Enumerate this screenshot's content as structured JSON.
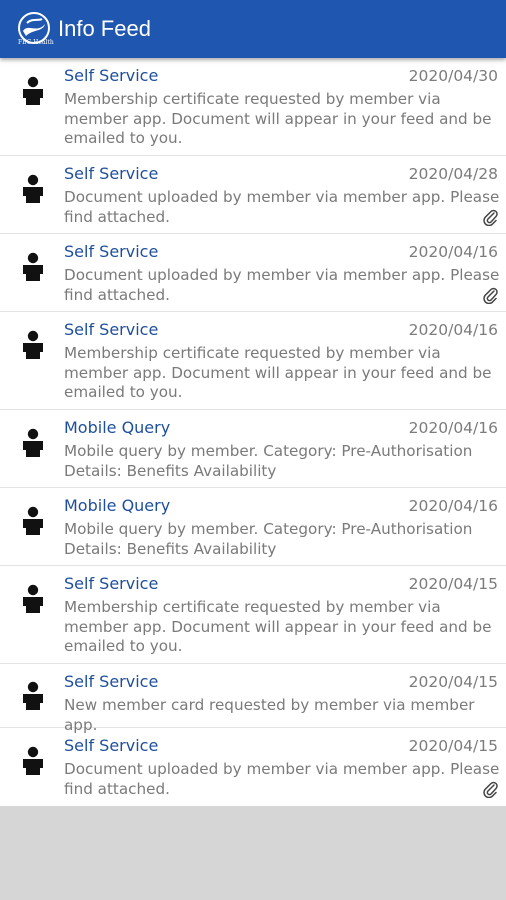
{
  "appbar": {
    "title": "Info Feed",
    "logo_text": "FBC Health",
    "color": "#1f56b0"
  },
  "feed": [
    {
      "source": "Self Service",
      "date": "2020/04/30",
      "text": "Membership certificate requested by member via member app. Document will appear in your feed and be emailed to you.",
      "attachment": false
    },
    {
      "source": "Self Service",
      "date": "2020/04/28",
      "text": "Document uploaded by member via member app. Please find attached.",
      "attachment": true
    },
    {
      "source": "Self Service",
      "date": "2020/04/16",
      "text": "Document uploaded by member via member app. Please find attached.",
      "attachment": true
    },
    {
      "source": "Self Service",
      "date": "2020/04/16",
      "text": "Membership certificate requested by member via member app. Document will appear in your feed and be emailed to you.",
      "attachment": false
    },
    {
      "source": "Mobile Query",
      "date": "2020/04/16",
      "text": "Mobile query by member.  Category: Pre-Authorisation Details: Benefits Availability",
      "attachment": false
    },
    {
      "source": "Mobile Query",
      "date": "2020/04/16",
      "text": "Mobile query by member.  Category: Pre-Authorisation Details: Benefits Availability",
      "attachment": false
    },
    {
      "source": "Self Service",
      "date": "2020/04/15",
      "text": "Membership certificate requested by member via member app. Document will appear in your feed and be emailed to you.",
      "attachment": false
    },
    {
      "source": "Self Service",
      "date": "2020/04/15",
      "text": "New member card requested by member via member app.",
      "attachment": false
    },
    {
      "source": "Self Service",
      "date": "2020/04/15",
      "text": "Document uploaded by member via member app. Please find attached.",
      "attachment": true
    }
  ],
  "icons": {
    "avatar": "person-icon",
    "attachment": "paperclip-icon"
  }
}
